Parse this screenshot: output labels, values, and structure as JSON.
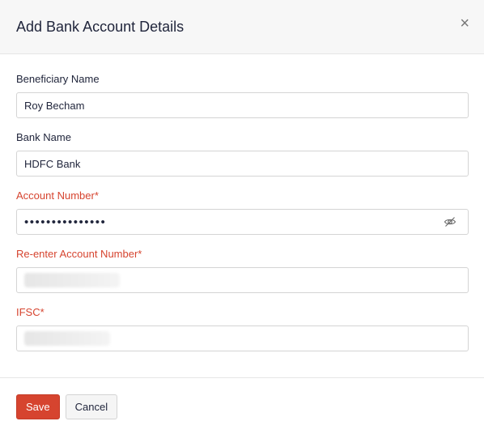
{
  "modal": {
    "title": "Add Bank Account Details",
    "close_icon": "close-icon"
  },
  "form": {
    "beneficiary_name": {
      "label": "Beneficiary Name",
      "value": "Roy Becham"
    },
    "bank_name": {
      "label": "Bank Name",
      "value": "HDFC Bank"
    },
    "account_number": {
      "label": "Account Number*",
      "masked_value": "•••••••••••••••",
      "toggle_icon": "eye-slash-icon"
    },
    "reenter_account_number": {
      "label": "Re-enter Account Number*"
    },
    "ifsc": {
      "label": "IFSC*"
    }
  },
  "footer": {
    "save_label": "Save",
    "cancel_label": "Cancel"
  },
  "colors": {
    "accent": "#d6442f",
    "header_bg": "#f7f7f7",
    "border": "#d4d4d4",
    "text": "#21263c"
  }
}
